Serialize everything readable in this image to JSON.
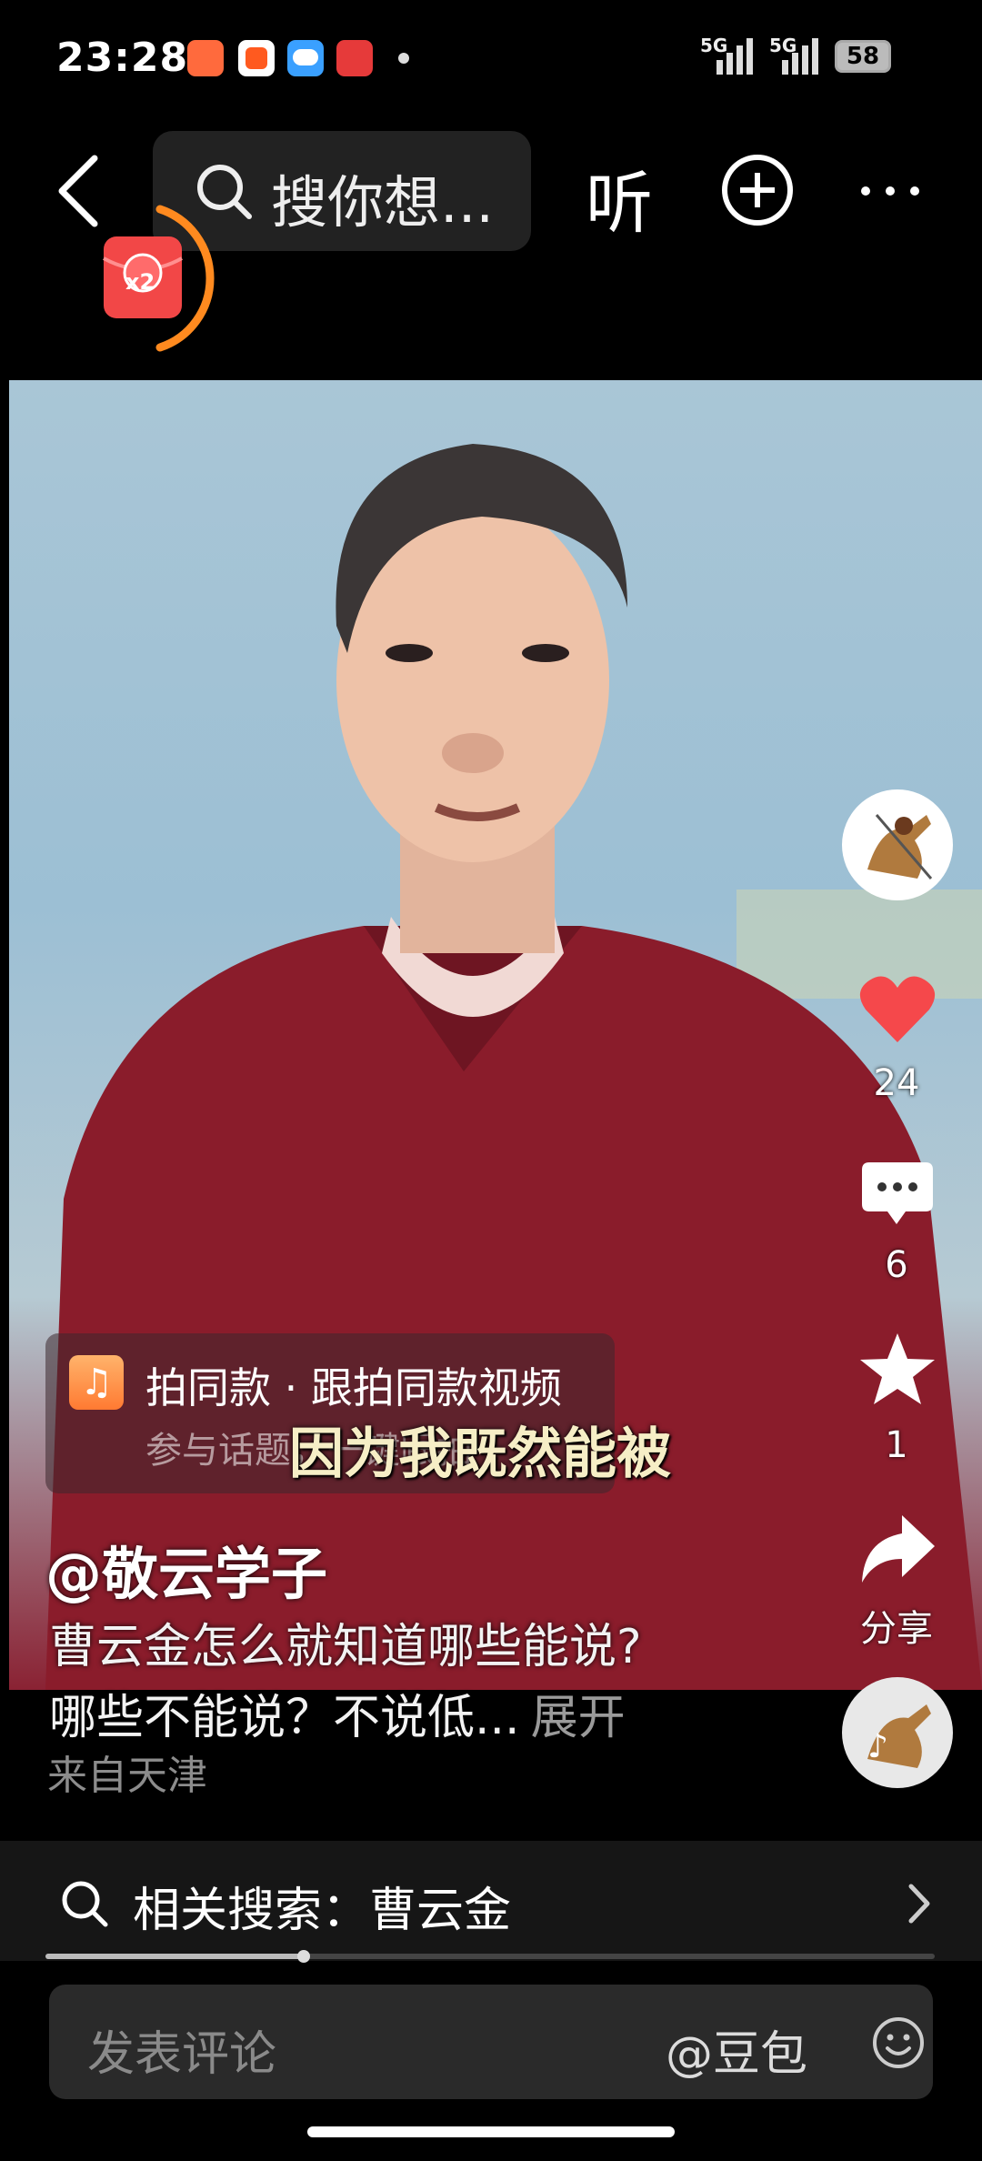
{
  "status_bar": {
    "time": "23:28",
    "network1": "5G",
    "network2": "5G",
    "battery": "58"
  },
  "top_bar": {
    "search_placeholder": "搜你想...",
    "listen_label": "听",
    "redpacket_badge": "x2"
  },
  "video": {
    "subtitle": "因为我既然能被"
  },
  "template_card": {
    "title": "拍同款 · 跟拍同款视频",
    "subtitle": "参与话题，一键跟拍"
  },
  "right_rail": {
    "like_count": "24",
    "comment_count": "6",
    "favorite_count": "1",
    "share_label": "分享"
  },
  "post": {
    "author": "@敬云学子",
    "desc_line1": "曹云金怎么就知道哪些能说?",
    "desc_line2": "哪些不能说？不说低...",
    "expand_label": "展开",
    "location": "来自天津"
  },
  "related_search": {
    "label": "相关搜索：曹云金",
    "progress": 0.29
  },
  "comment_bar": {
    "placeholder": "发表评论",
    "mention": "@豆包"
  },
  "colors": {
    "like": "#f5484b",
    "accent_ring": "#ff8a1f"
  }
}
